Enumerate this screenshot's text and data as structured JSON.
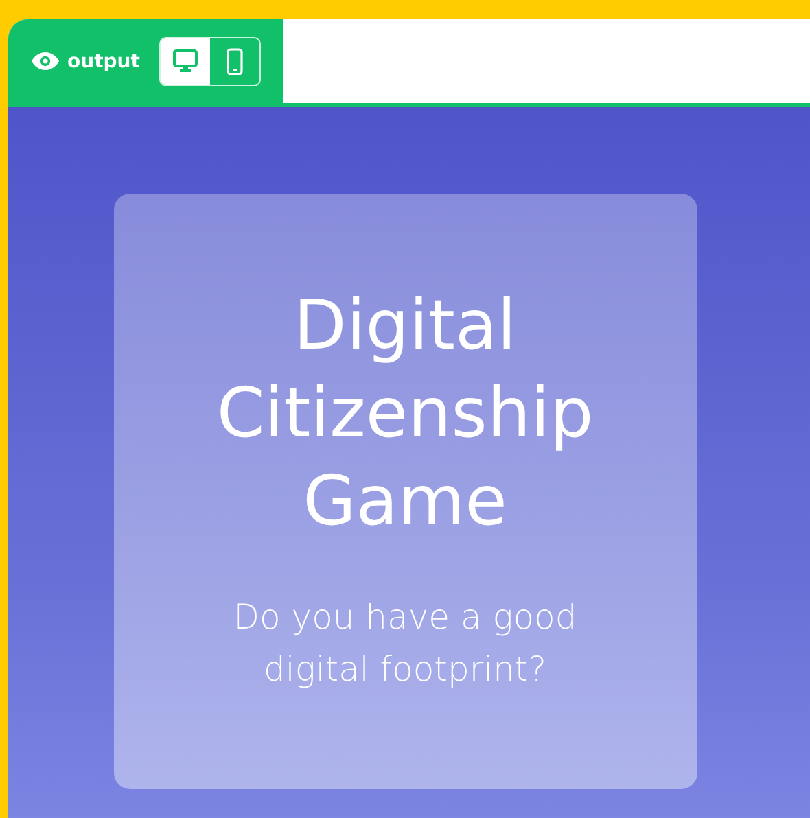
{
  "toolbar": {
    "label": "output",
    "devices": [
      {
        "kind": "desktop",
        "selected": true
      },
      {
        "kind": "mobile",
        "selected": false
      }
    ]
  },
  "card": {
    "title": "Digital Citizenship Game",
    "subtitle": "Do you have a good digital footprint?"
  }
}
